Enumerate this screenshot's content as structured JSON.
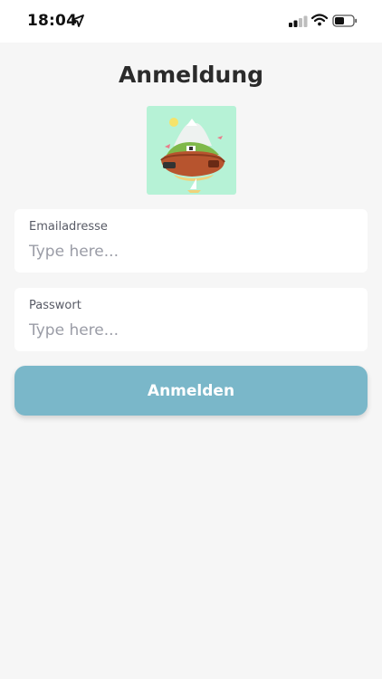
{
  "status_bar": {
    "time": "18:04",
    "icons": [
      "location-arrow-icon",
      "cellular-signal-icon",
      "wifi-icon",
      "battery-icon"
    ]
  },
  "page": {
    "title": "Anmeldung"
  },
  "logo": {
    "name": "island-illustration-logo"
  },
  "form": {
    "email": {
      "label": "Emailadresse",
      "placeholder": "Type here...",
      "value": ""
    },
    "password": {
      "label": "Passwort",
      "placeholder": "Type here...",
      "value": ""
    },
    "submit_label": "Anmelden"
  },
  "colors": {
    "background": "#f6f6f6",
    "button": "#7ab7c9",
    "logo_background": "#b6f2d6",
    "title": "#2b2b2b"
  }
}
